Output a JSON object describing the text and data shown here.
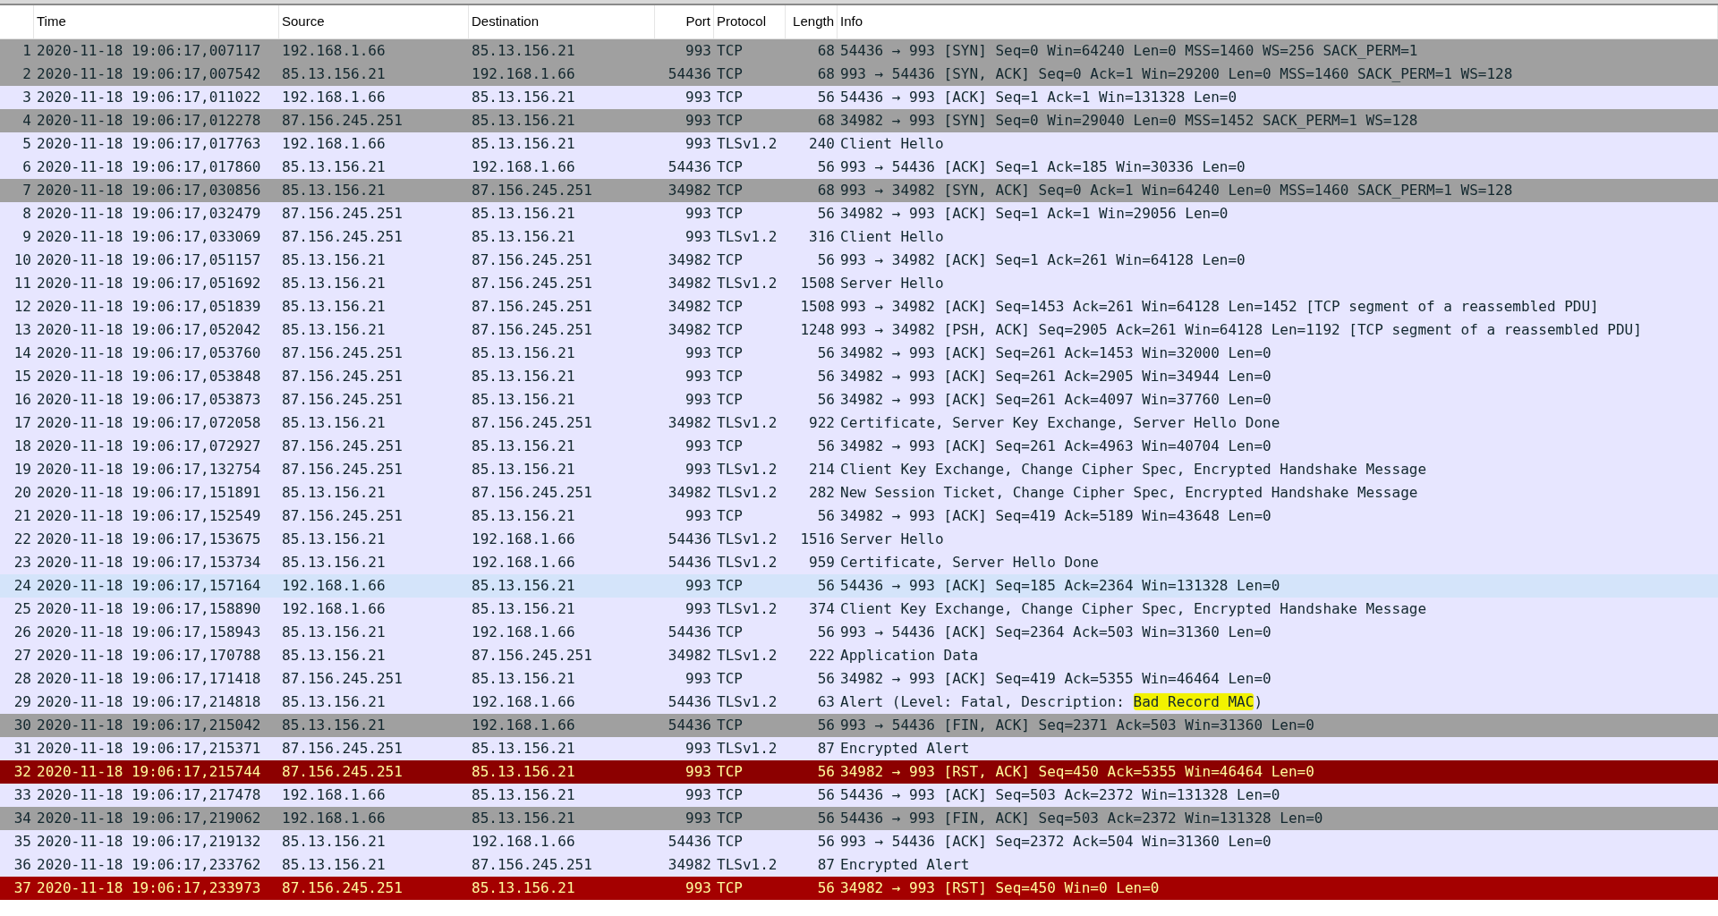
{
  "columns": [
    "Time",
    "Source",
    "Destination",
    "Port",
    "Protocol",
    "Length",
    "Info"
  ],
  "rows": [
    {
      "no": "1",
      "time": "2020-11-18 19:06:17,007117",
      "source": "192.168.1.66",
      "destination": "85.13.156.21",
      "port": "993",
      "protocol": "TCP",
      "length": "68",
      "info": "54436 → 993 [SYN] Seq=0 Win=64240 Len=0 MSS=1460 WS=256 SACK_PERM=1",
      "kind": "syn"
    },
    {
      "no": "2",
      "time": "2020-11-18 19:06:17,007542",
      "source": "85.13.156.21",
      "destination": "192.168.1.66",
      "port": "54436",
      "protocol": "TCP",
      "length": "68",
      "info": "993 → 54436 [SYN, ACK] Seq=0 Ack=1 Win=29200 Len=0 MSS=1460 SACK_PERM=1 WS=128",
      "kind": "syn"
    },
    {
      "no": "3",
      "time": "2020-11-18 19:06:17,011022",
      "source": "192.168.1.66",
      "destination": "85.13.156.21",
      "port": "993",
      "protocol": "TCP",
      "length": "56",
      "info": "54436 → 993 [ACK] Seq=1 Ack=1 Win=131328 Len=0",
      "kind": "plain"
    },
    {
      "no": "4",
      "time": "2020-11-18 19:06:17,012278",
      "source": "87.156.245.251",
      "destination": "85.13.156.21",
      "port": "993",
      "protocol": "TCP",
      "length": "68",
      "info": "34982 → 993 [SYN] Seq=0 Win=29040 Len=0 MSS=1452 SACK_PERM=1 WS=128",
      "kind": "syn"
    },
    {
      "no": "5",
      "time": "2020-11-18 19:06:17,017763",
      "source": "192.168.1.66",
      "destination": "85.13.156.21",
      "port": "993",
      "protocol": "TLSv1.2",
      "length": "240",
      "info": "Client Hello",
      "kind": "plain"
    },
    {
      "no": "6",
      "time": "2020-11-18 19:06:17,017860",
      "source": "85.13.156.21",
      "destination": "192.168.1.66",
      "port": "54436",
      "protocol": "TCP",
      "length": "56",
      "info": "993 → 54436 [ACK] Seq=1 Ack=185 Win=30336 Len=0",
      "kind": "plain"
    },
    {
      "no": "7",
      "time": "2020-11-18 19:06:17,030856",
      "source": "85.13.156.21",
      "destination": "87.156.245.251",
      "port": "34982",
      "protocol": "TCP",
      "length": "68",
      "info": "993 → 34982 [SYN, ACK] Seq=0 Ack=1 Win=64240 Len=0 MSS=1460 SACK_PERM=1 WS=128",
      "kind": "syn"
    },
    {
      "no": "8",
      "time": "2020-11-18 19:06:17,032479",
      "source": "87.156.245.251",
      "destination": "85.13.156.21",
      "port": "993",
      "protocol": "TCP",
      "length": "56",
      "info": "34982 → 993 [ACK] Seq=1 Ack=1 Win=29056 Len=0",
      "kind": "plain"
    },
    {
      "no": "9",
      "time": "2020-11-18 19:06:17,033069",
      "source": "87.156.245.251",
      "destination": "85.13.156.21",
      "port": "993",
      "protocol": "TLSv1.2",
      "length": "316",
      "info": "Client Hello",
      "kind": "plain"
    },
    {
      "no": "10",
      "time": "2020-11-18 19:06:17,051157",
      "source": "85.13.156.21",
      "destination": "87.156.245.251",
      "port": "34982",
      "protocol": "TCP",
      "length": "56",
      "info": "993 → 34982 [ACK] Seq=1 Ack=261 Win=64128 Len=0",
      "kind": "plain"
    },
    {
      "no": "11",
      "time": "2020-11-18 19:06:17,051692",
      "source": "85.13.156.21",
      "destination": "87.156.245.251",
      "port": "34982",
      "protocol": "TLSv1.2",
      "length": "1508",
      "info": "Server Hello",
      "kind": "plain"
    },
    {
      "no": "12",
      "time": "2020-11-18 19:06:17,051839",
      "source": "85.13.156.21",
      "destination": "87.156.245.251",
      "port": "34982",
      "protocol": "TCP",
      "length": "1508",
      "info": "993 → 34982 [ACK] Seq=1453 Ack=261 Win=64128 Len=1452 [TCP segment of a reassembled PDU]",
      "kind": "plain"
    },
    {
      "no": "13",
      "time": "2020-11-18 19:06:17,052042",
      "source": "85.13.156.21",
      "destination": "87.156.245.251",
      "port": "34982",
      "protocol": "TCP",
      "length": "1248",
      "info": "993 → 34982 [PSH, ACK] Seq=2905 Ack=261 Win=64128 Len=1192 [TCP segment of a reassembled PDU]",
      "kind": "plain"
    },
    {
      "no": "14",
      "time": "2020-11-18 19:06:17,053760",
      "source": "87.156.245.251",
      "destination": "85.13.156.21",
      "port": "993",
      "protocol": "TCP",
      "length": "56",
      "info": "34982 → 993 [ACK] Seq=261 Ack=1453 Win=32000 Len=0",
      "kind": "plain"
    },
    {
      "no": "15",
      "time": "2020-11-18 19:06:17,053848",
      "source": "87.156.245.251",
      "destination": "85.13.156.21",
      "port": "993",
      "protocol": "TCP",
      "length": "56",
      "info": "34982 → 993 [ACK] Seq=261 Ack=2905 Win=34944 Len=0",
      "kind": "plain"
    },
    {
      "no": "16",
      "time": "2020-11-18 19:06:17,053873",
      "source": "87.156.245.251",
      "destination": "85.13.156.21",
      "port": "993",
      "protocol": "TCP",
      "length": "56",
      "info": "34982 → 993 [ACK] Seq=261 Ack=4097 Win=37760 Len=0",
      "kind": "plain"
    },
    {
      "no": "17",
      "time": "2020-11-18 19:06:17,072058",
      "source": "85.13.156.21",
      "destination": "87.156.245.251",
      "port": "34982",
      "protocol": "TLSv1.2",
      "length": "922",
      "info": "Certificate, Server Key Exchange, Server Hello Done",
      "kind": "plain"
    },
    {
      "no": "18",
      "time": "2020-11-18 19:06:17,072927",
      "source": "87.156.245.251",
      "destination": "85.13.156.21",
      "port": "993",
      "protocol": "TCP",
      "length": "56",
      "info": "34982 → 993 [ACK] Seq=261 Ack=4963 Win=40704 Len=0",
      "kind": "plain"
    },
    {
      "no": "19",
      "time": "2020-11-18 19:06:17,132754",
      "source": "87.156.245.251",
      "destination": "85.13.156.21",
      "port": "993",
      "protocol": "TLSv1.2",
      "length": "214",
      "info": "Client Key Exchange, Change Cipher Spec, Encrypted Handshake Message",
      "kind": "plain"
    },
    {
      "no": "20",
      "time": "2020-11-18 19:06:17,151891",
      "source": "85.13.156.21",
      "destination": "87.156.245.251",
      "port": "34982",
      "protocol": "TLSv1.2",
      "length": "282",
      "info": "New Session Ticket, Change Cipher Spec, Encrypted Handshake Message",
      "kind": "plain"
    },
    {
      "no": "21",
      "time": "2020-11-18 19:06:17,152549",
      "source": "87.156.245.251",
      "destination": "85.13.156.21",
      "port": "993",
      "protocol": "TCP",
      "length": "56",
      "info": "34982 → 993 [ACK] Seq=419 Ack=5189 Win=43648 Len=0",
      "kind": "plain"
    },
    {
      "no": "22",
      "time": "2020-11-18 19:06:17,153675",
      "source": "85.13.156.21",
      "destination": "192.168.1.66",
      "port": "54436",
      "protocol": "TLSv1.2",
      "length": "1516",
      "info": "Server Hello",
      "kind": "plain"
    },
    {
      "no": "23",
      "time": "2020-11-18 19:06:17,153734",
      "source": "85.13.156.21",
      "destination": "192.168.1.66",
      "port": "54436",
      "protocol": "TLSv1.2",
      "length": "959",
      "info": "Certificate, Server Hello Done",
      "kind": "plain"
    },
    {
      "no": "24",
      "time": "2020-11-18 19:06:17,157164",
      "source": "192.168.1.66",
      "destination": "85.13.156.21",
      "port": "993",
      "protocol": "TCP",
      "length": "56",
      "info": "54436 → 993 [ACK] Seq=185 Ack=2364 Win=131328 Len=0",
      "kind": "hover"
    },
    {
      "no": "25",
      "time": "2020-11-18 19:06:17,158890",
      "source": "192.168.1.66",
      "destination": "85.13.156.21",
      "port": "993",
      "protocol": "TLSv1.2",
      "length": "374",
      "info": "Client Key Exchange, Change Cipher Spec, Encrypted Handshake Message",
      "kind": "plain"
    },
    {
      "no": "26",
      "time": "2020-11-18 19:06:17,158943",
      "source": "85.13.156.21",
      "destination": "192.168.1.66",
      "port": "54436",
      "protocol": "TCP",
      "length": "56",
      "info": "993 → 54436 [ACK] Seq=2364 Ack=503 Win=31360 Len=0",
      "kind": "plain"
    },
    {
      "no": "27",
      "time": "2020-11-18 19:06:17,170788",
      "source": "85.13.156.21",
      "destination": "87.156.245.251",
      "port": "34982",
      "protocol": "TLSv1.2",
      "length": "222",
      "info": "Application Data",
      "kind": "plain"
    },
    {
      "no": "28",
      "time": "2020-11-18 19:06:17,171418",
      "source": "87.156.245.251",
      "destination": "85.13.156.21",
      "port": "993",
      "protocol": "TCP",
      "length": "56",
      "info": "34982 → 993 [ACK] Seq=419 Ack=5355 Win=46464 Len=0",
      "kind": "plain"
    },
    {
      "no": "29",
      "time": "2020-11-18 19:06:17,214818",
      "source": "85.13.156.21",
      "destination": "192.168.1.66",
      "port": "54436",
      "protocol": "TLSv1.2",
      "length": "63",
      "info": "Alert (Level: Fatal, Description: ",
      "info_marked": "Bad Record MAC",
      "info_after": ")",
      "kind": "plain"
    },
    {
      "no": "30",
      "time": "2020-11-18 19:06:17,215042",
      "source": "85.13.156.21",
      "destination": "192.168.1.66",
      "port": "54436",
      "protocol": "TCP",
      "length": "56",
      "info": "993 → 54436 [FIN, ACK] Seq=2371 Ack=503 Win=31360 Len=0",
      "kind": "syn"
    },
    {
      "no": "31",
      "time": "2020-11-18 19:06:17,215371",
      "source": "87.156.245.251",
      "destination": "85.13.156.21",
      "port": "993",
      "protocol": "TLSv1.2",
      "length": "87",
      "info": "Encrypted Alert",
      "kind": "plain"
    },
    {
      "no": "32",
      "time": "2020-11-18 19:06:17,215744",
      "source": "87.156.245.251",
      "destination": "85.13.156.21",
      "port": "993",
      "protocol": "TCP",
      "length": "56",
      "info": "34982 → 993 [RST, ACK] Seq=450 Ack=5355 Win=46464 Len=0",
      "kind": "rst_dark"
    },
    {
      "no": "33",
      "time": "2020-11-18 19:06:17,217478",
      "source": "192.168.1.66",
      "destination": "85.13.156.21",
      "port": "993",
      "protocol": "TCP",
      "length": "56",
      "info": "54436 → 993 [ACK] Seq=503 Ack=2372 Win=131328 Len=0",
      "kind": "plain"
    },
    {
      "no": "34",
      "time": "2020-11-18 19:06:17,219062",
      "source": "192.168.1.66",
      "destination": "85.13.156.21",
      "port": "993",
      "protocol": "TCP",
      "length": "56",
      "info": "54436 → 993 [FIN, ACK] Seq=503 Ack=2372 Win=131328 Len=0",
      "kind": "syn"
    },
    {
      "no": "35",
      "time": "2020-11-18 19:06:17,219132",
      "source": "85.13.156.21",
      "destination": "192.168.1.66",
      "port": "54436",
      "protocol": "TCP",
      "length": "56",
      "info": "993 → 54436 [ACK] Seq=2372 Ack=504 Win=31360 Len=0",
      "kind": "plain"
    },
    {
      "no": "36",
      "time": "2020-11-18 19:06:17,233762",
      "source": "85.13.156.21",
      "destination": "87.156.245.251",
      "port": "34982",
      "protocol": "TLSv1.2",
      "length": "87",
      "info": "Encrypted Alert",
      "kind": "plain"
    },
    {
      "no": "37",
      "time": "2020-11-18 19:06:17,233973",
      "source": "87.156.245.251",
      "destination": "85.13.156.21",
      "port": "993",
      "protocol": "TCP",
      "length": "56",
      "info": "34982 → 993 [RST] Seq=450 Win=0 Len=0",
      "kind": "rst"
    }
  ]
}
